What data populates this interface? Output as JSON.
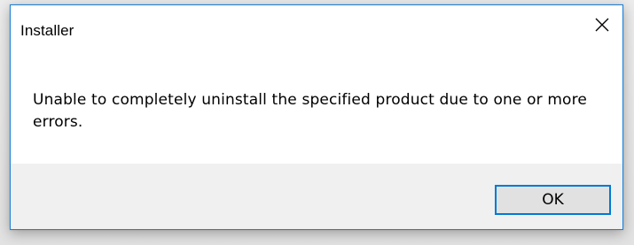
{
  "dialog": {
    "title": "Installer",
    "message": "Unable to completely uninstall the specified product due to one or more errors.",
    "buttons": {
      "ok_label": "OK"
    },
    "icons": {
      "close": "close-icon"
    },
    "colors": {
      "border_accent": "#1c7fd6",
      "button_focus_border": "#0078d7",
      "footer_bg": "#f0f0f0",
      "button_bg": "#e1e1e1"
    }
  }
}
